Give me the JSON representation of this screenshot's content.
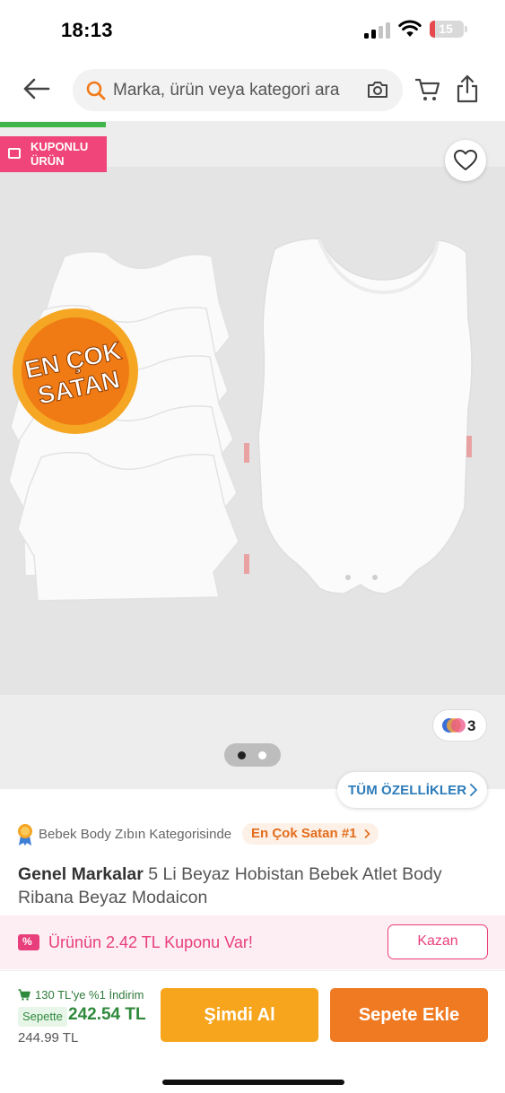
{
  "status_bar": {
    "time": "18:13",
    "battery_level": "15",
    "battery_color": "#e5484d"
  },
  "header": {
    "back_icon": "arrow-left-icon",
    "search_placeholder": "Marka, ürün veya kategori ara",
    "search_icon": "magnifier-icon",
    "camera_icon": "camera-icon",
    "cart_icon": "cart-icon",
    "share_icon": "share-icon"
  },
  "gallery": {
    "coupon_badge_line1": "KUPONLU",
    "coupon_badge_line2": "ÜRÜN",
    "best_seller_line1": "EN ÇOK",
    "best_seller_line2": "SATAN",
    "color_variant_count": "3",
    "current_page": 1,
    "total_pages": 2,
    "progress_fraction": 0.21,
    "brand_color": "#3fb44a"
  },
  "features_button": "TÜM ÖZELLİKLER",
  "ranking": {
    "category_text": "Bebek Body Zıbın Kategorisinde",
    "rank_text": "En Çok Satan #1"
  },
  "product": {
    "brand": "Genel Markalar",
    "name": "5 Li Beyaz Hobistan Bebek Atlet Body Ribana Beyaz Modaicon"
  },
  "coupon": {
    "icon_text": "%",
    "text": "Ürünün 2.42 TL Kuponu Var!",
    "button": "Kazan",
    "accent_color": "#e83e7b"
  },
  "pricing": {
    "discount_text": "130 TL'ye %1 İndirim",
    "basket_label": "Sepette",
    "basket_price": "242.54 TL",
    "old_price": "244.99 TL"
  },
  "actions": {
    "buy_now": "Şimdi Al",
    "add_to_cart": "Sepete Ekle"
  }
}
